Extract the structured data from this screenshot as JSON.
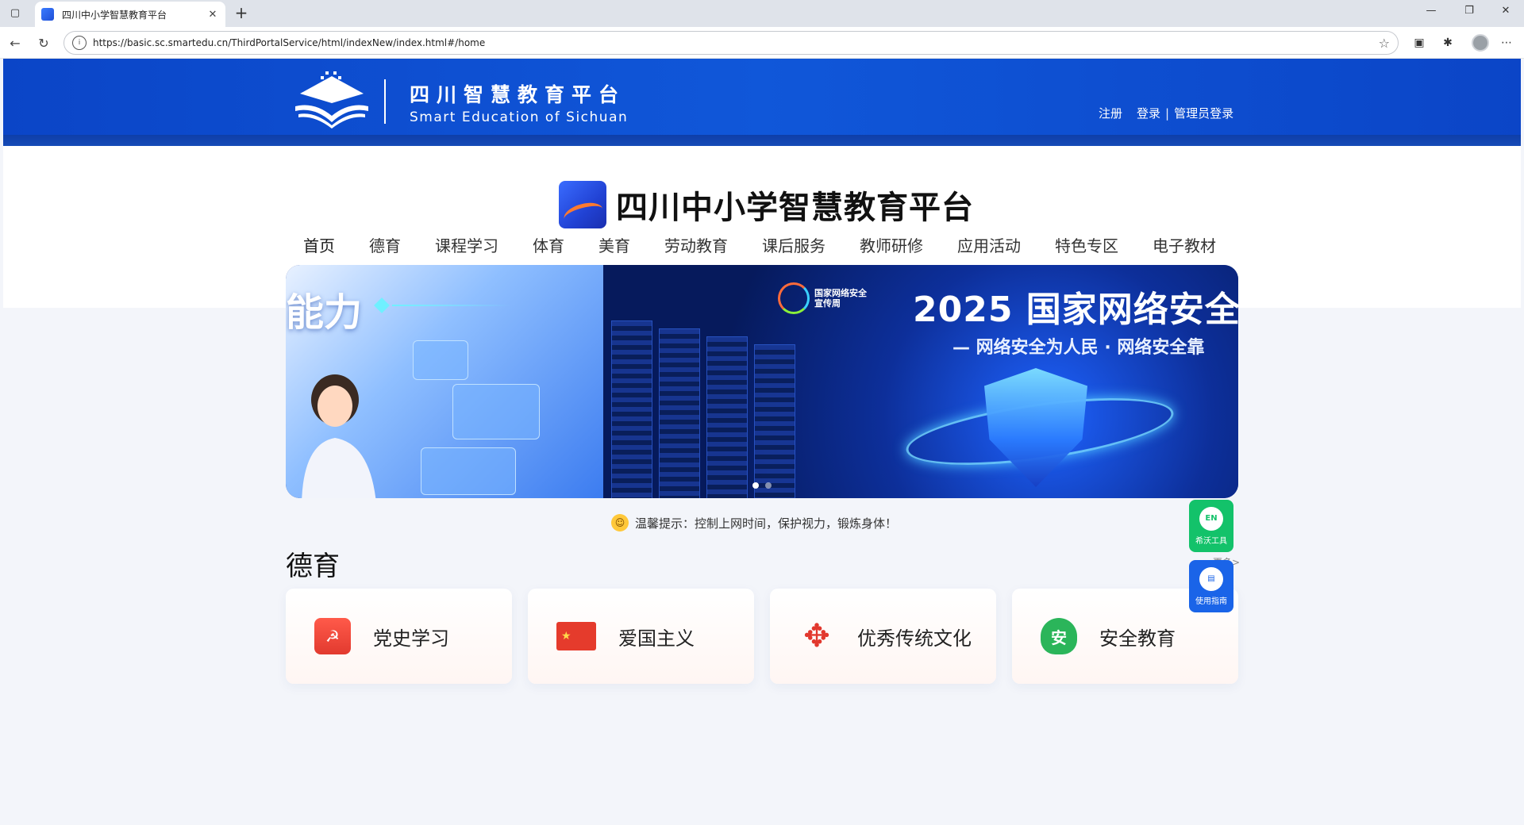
{
  "browser": {
    "tab_title": "四川中小学智慧教育平台",
    "url": "https://basic.sc.smartedu.cn/ThirdPortalService/html/indexNew/index.html#/home"
  },
  "header": {
    "logo_cn": "四川智慧教育平台",
    "logo_en": "Smart Education of Sichuan",
    "links": {
      "register": "注册",
      "login": "登录",
      "separator": "|",
      "admin_login": "管理员登录"
    }
  },
  "brand": {
    "title": "四川中小学智慧教育平台"
  },
  "nav": {
    "items": [
      "首页",
      "德育",
      "课程学习",
      "体育",
      "美育",
      "劳动教育",
      "课后服务",
      "教师研修",
      "应用活动",
      "特色专区",
      "电子教材"
    ],
    "active_index": 0
  },
  "banner": {
    "left_text": "能力",
    "week_logo_line1": "国家网络安全",
    "week_logo_line2": "宣传周",
    "headline": "2025 国家网络安全",
    "subline": "— 网络安全为人民 · 网络安全靠",
    "slide_count": 2,
    "active_slide": 0
  },
  "tip": {
    "text": "温馨提示：控制上网时间，保护视力，锻炼身体！"
  },
  "section": {
    "title": "德育",
    "more": "更多>",
    "cards": [
      {
        "label": "党史学习",
        "icon": "party-book-icon"
      },
      {
        "label": "爱国主义",
        "icon": "china-flag-icon"
      },
      {
        "label": "优秀传统文化",
        "icon": "chinese-knot-icon"
      },
      {
        "label": "安全教育",
        "icon": "safety-shield-icon"
      }
    ]
  },
  "floating": {
    "tool_label": "希沃工具",
    "tool_badge": "EN",
    "guide_label": "使用指南"
  },
  "colors": {
    "header_blue": "#1057d9",
    "nav_active": "#1f6fe8",
    "float_green": "#13c26a",
    "float_blue": "#1a64e8"
  }
}
